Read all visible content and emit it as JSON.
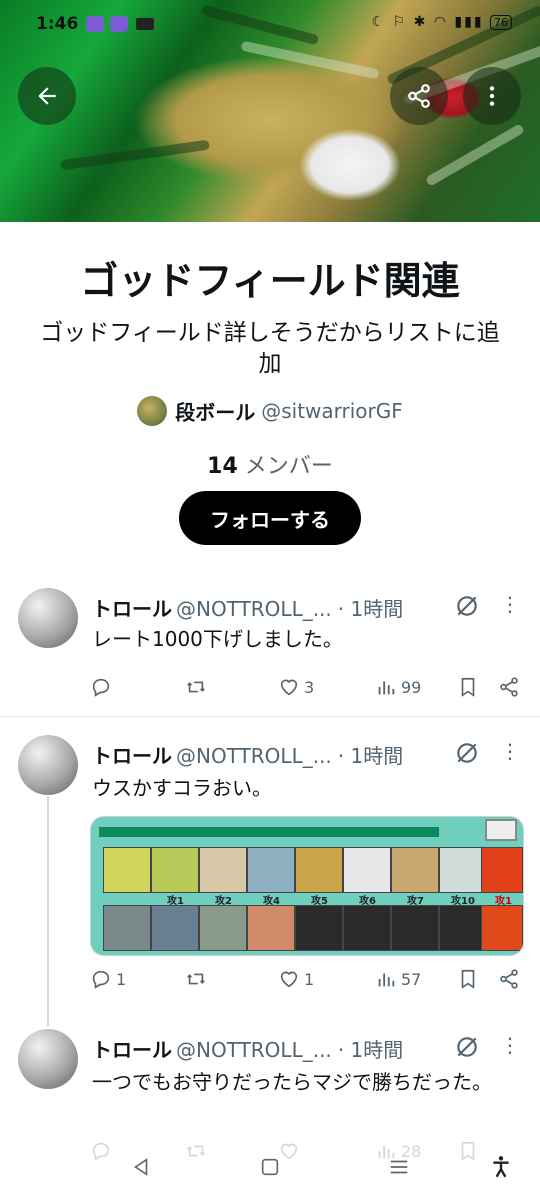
{
  "status_bar": {
    "time": "1:46",
    "battery": "76"
  },
  "list": {
    "title": "ゴッドフィールド関連",
    "description": "ゴッドフィールド詳しそうだからリストに追加",
    "owner_name": "段ボール",
    "owner_handle": "@sitwarriorGF",
    "member_count": "14",
    "member_label": "メンバー",
    "follow_label": "フォローする"
  },
  "tweets": [
    {
      "name": "トロール",
      "handle": "@NOTTROLL_...",
      "time": "· 1時間",
      "text": "レート1000下げしました。",
      "replies": "",
      "retweets": "",
      "likes": "3",
      "views": "99"
    },
    {
      "name": "トロール",
      "handle": "@NOTTROLL_...",
      "time": "· 1時間",
      "text": "ウスかすコラおい。",
      "replies": "1",
      "retweets": "",
      "likes": "1",
      "views": "57",
      "media_captions": [
        "攻1",
        "攻2",
        "攻4",
        "攻5",
        "攻6",
        "攻7",
        "攻10",
        "攻1"
      ]
    },
    {
      "name": "トロール",
      "handle": "@NOTTROLL_...",
      "time": "· 1時間",
      "text": "一つでもお守りだったらマジで勝ちだった。",
      "replies": "",
      "retweets": "",
      "likes": "",
      "views": "28"
    }
  ],
  "colors": {
    "accent": "#000000",
    "secondary_text": "#536471"
  }
}
